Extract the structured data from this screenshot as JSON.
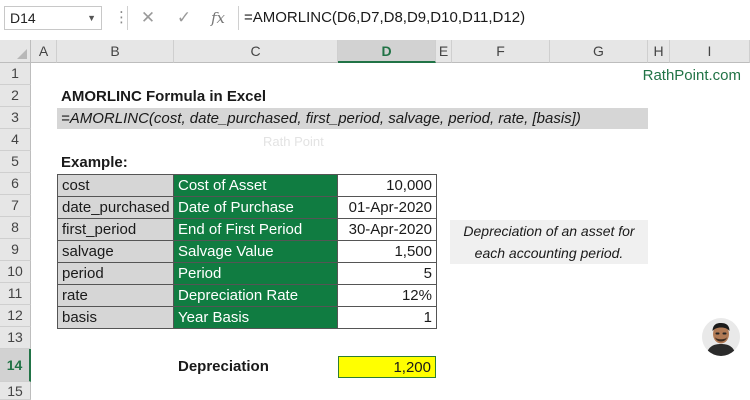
{
  "formula_bar": {
    "name_box": "D14",
    "cancel_icon": "✕",
    "enter_icon": "✓",
    "fx_icon": "fx",
    "formula": "=AMORLINC(D6,D7,D8,D9,D10,D11,D12)"
  },
  "columns": [
    "A",
    "B",
    "C",
    "D",
    "E",
    "F",
    "G",
    "H",
    "I"
  ],
  "rows": [
    "1",
    "2",
    "3",
    "4",
    "5",
    "6",
    "7",
    "8",
    "9",
    "10",
    "11",
    "12",
    "13",
    "14",
    "15"
  ],
  "selected_cell": "D14",
  "sheet": {
    "brand": "RathPoint.com",
    "title": "AMORLINC Formula in Excel",
    "syntax": "=AMORLINC(cost, date_purchased, first_period, salvage, period, rate, [basis])",
    "watermark": "Rath Point",
    "example_label": "Example:",
    "params": [
      {
        "arg": "cost",
        "desc": "Cost of Asset",
        "value": "10,000"
      },
      {
        "arg": "date_purchased",
        "desc": "Date of Purchase",
        "value": "01-Apr-2020"
      },
      {
        "arg": "first_period",
        "desc": "End of First Period",
        "value": "30-Apr-2020"
      },
      {
        "arg": "salvage",
        "desc": "Salvage Value",
        "value": "1,500"
      },
      {
        "arg": "period",
        "desc": "Period",
        "value": "5"
      },
      {
        "arg": "rate",
        "desc": "Depreciation Rate",
        "value": "12%"
      },
      {
        "arg": "basis",
        "desc": "Year Basis",
        "value": "1"
      }
    ],
    "note_line1": "Depreciation of an asset for",
    "note_line2": "each accounting period.",
    "result_label": "Depreciation",
    "result_value": "1,200"
  },
  "colors": {
    "header_green": "#107c41",
    "selection_green": "#217346",
    "param_gray": "#d6d6d6",
    "result_yellow": "#ffff00"
  }
}
